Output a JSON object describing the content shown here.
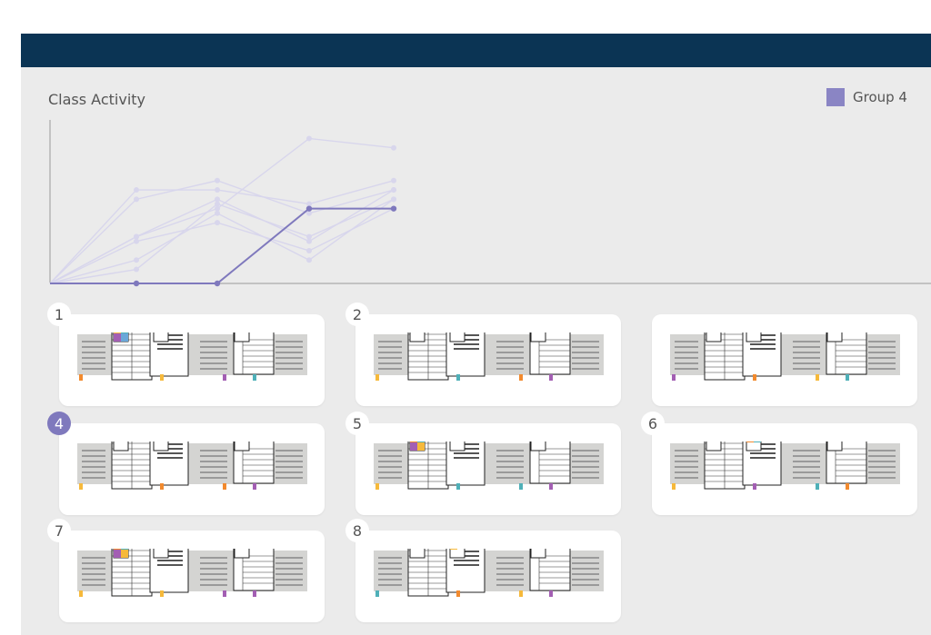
{
  "app": {
    "title": "Class Activity",
    "legend": {
      "label": "Group 4",
      "color": "#8a85c4"
    }
  },
  "chart_data": {
    "type": "line",
    "title": "",
    "x": [
      0,
      1,
      2,
      3,
      4
    ],
    "highlight_series": "Group 4",
    "series": [
      {
        "values": [
          0,
          1.0,
          1.6,
          3.1,
          2.9
        ]
      },
      {
        "values": [
          0,
          2.0,
          2.0,
          1.7,
          2.2
        ]
      },
      {
        "values": [
          0,
          1.8,
          2.2,
          1.5,
          2.0
        ]
      },
      {
        "values": [
          0,
          1.0,
          1.8,
          0.9,
          2.0
        ]
      },
      {
        "values": [
          0,
          0.5,
          1.5,
          0.5,
          1.8
        ]
      },
      {
        "values": [
          0,
          0.9,
          1.3,
          0.7,
          1.6
        ]
      },
      {
        "values": [
          0,
          0.3,
          1.7,
          1.0,
          1.8
        ]
      },
      {
        "name": "Group 4",
        "values": [
          0,
          0,
          0,
          1.6,
          1.6
        ]
      }
    ],
    "ylim": [
      0,
      3.4
    ],
    "colors": {
      "faint": "#d8d6ec",
      "highlight": "#7f79bd",
      "axis": "#9a9a9a"
    }
  },
  "cards": [
    {
      "label": "1",
      "active": false,
      "tabs": [
        "#f28a2e",
        "#f6b93b",
        "#a35fb3",
        "#4fb0b8"
      ],
      "chips": [
        "#f6b93b",
        "#4fb0b8",
        "#a35fb3",
        "#6aa7d8"
      ]
    },
    {
      "label": "2",
      "active": false,
      "tabs": [
        "#f6b93b",
        "#4fb0b8",
        "#f28a2e",
        "#a35fb3"
      ],
      "chips": []
    },
    {
      "label": "",
      "active": false,
      "tabs": [
        "#a35fb3",
        "#f28a2e",
        "#f6b93b",
        "#4fb0b8"
      ],
      "chips": []
    },
    {
      "label": "4",
      "active": true,
      "tabs": [
        "#f6b93b",
        "#f28a2e",
        "#f28a2e",
        "#a35fb3"
      ],
      "chips": []
    },
    {
      "label": "5",
      "active": false,
      "tabs": [
        "#f6b93b",
        "#4fb0b8",
        "#4fb0b8",
        "#a35fb3"
      ],
      "chips": [
        "#f28a2e",
        "#4fb0b8",
        "#a35fb3",
        "#f6b93b"
      ]
    },
    {
      "label": "6",
      "active": false,
      "tabs": [
        "#f6b93b",
        "#a35fb3",
        "#4fb0b8",
        "#f28a2e"
      ],
      "chips": [
        "#f28a2e",
        "#4fb0b8"
      ]
    },
    {
      "label": "7",
      "active": false,
      "tabs": [
        "#f6b93b",
        "#f6b93b",
        "#a35fb3",
        "#a35fb3"
      ],
      "chips": [
        "#f28a2e",
        "#4fb0b8",
        "#a35fb3",
        "#f6b93b"
      ]
    },
    {
      "label": "8",
      "active": false,
      "tabs": [
        "#4fb0b8",
        "#f28a2e",
        "#f6b93b",
        "#a35fb3"
      ],
      "chips": [
        "#f6b93b"
      ]
    }
  ]
}
